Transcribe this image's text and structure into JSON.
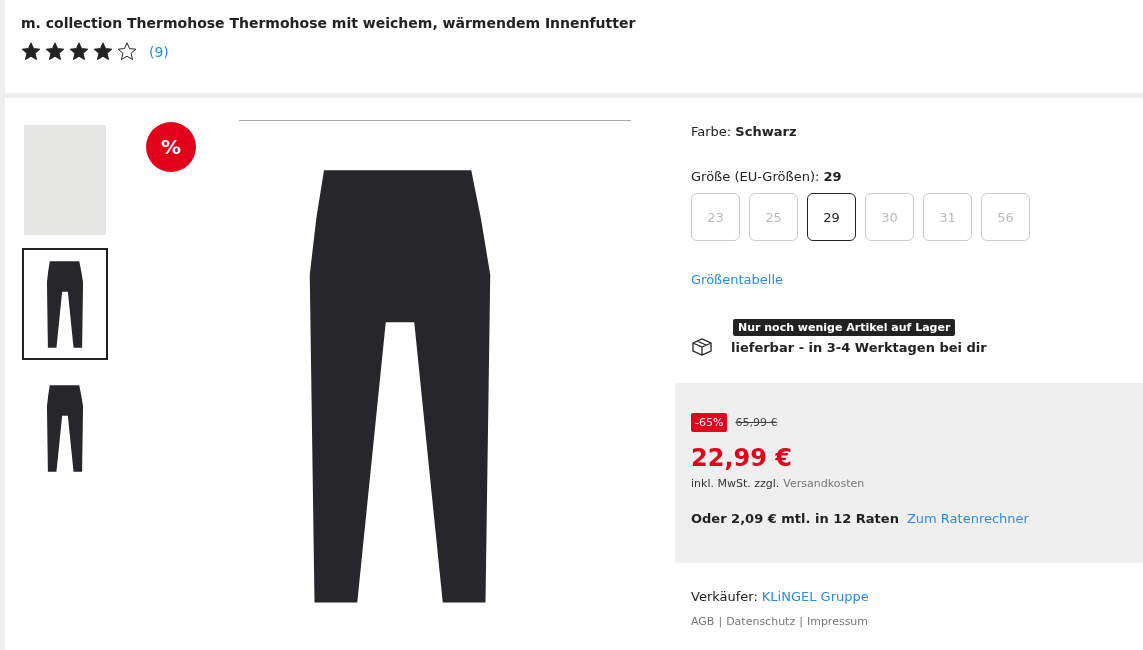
{
  "title": "m. collection Thermohose Thermohose mit weichem, wärmendem Innenfutter",
  "rating": {
    "stars": 4,
    "count": "(9)"
  },
  "thumbnails": [
    {
      "kind": "photo",
      "selected": false
    },
    {
      "kind": "product",
      "selected": true
    },
    {
      "kind": "product",
      "selected": false
    }
  ],
  "sale_badge": "%",
  "color_label": "Farbe: **Schwarz**",
  "size_label": "Größe (EU-Größen): **29**",
  "sizes": [
    {
      "label": "23",
      "selected": false,
      "available": false
    },
    {
      "label": "25",
      "selected": false,
      "available": false
    },
    {
      "label": "29",
      "selected": true,
      "available": true
    },
    {
      "label": "30",
      "selected": false,
      "available": false
    },
    {
      "label": "31",
      "selected": false,
      "available": false
    },
    {
      "label": "56",
      "selected": false,
      "available": false
    }
  ],
  "size_chart_link": "Größentabelle",
  "stock_note": "Nur noch wenige Artikel auf Lager",
  "delivery": "lieferbar - in 3-4 Werktagen bei dir",
  "price": {
    "discount": "-65%",
    "old_price": "65,99 €",
    "price": "22,99 €",
    "tax_note": "inkl. MwSt. zzgl.",
    "shipping_link": "Versandkosten",
    "installment": "Oder 2,09 € mtl. in 12 Raten",
    "installment_link": "Zum Ratenrechner"
  },
  "seller": {
    "label": "Verkäufer:",
    "name": "KLiNGEL Gruppe",
    "links": [
      "AGB",
      "Datenschutz",
      "Impressum"
    ],
    "separator": "|"
  }
}
